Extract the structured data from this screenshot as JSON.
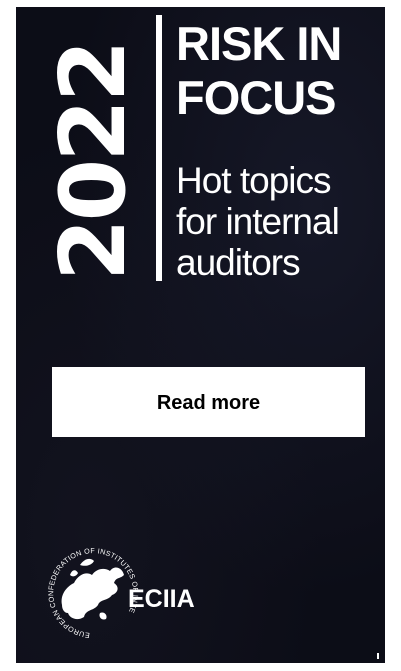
{
  "banner": {
    "year": "2022",
    "title_lines": [
      "RISK IN",
      "FOCUS"
    ],
    "subtitle_lines": [
      "Hot topics",
      "for internal",
      "auditors"
    ],
    "cta_label": "Read more",
    "logo": {
      "name": "ECIIA",
      "ring_text": "EUROPEAN CONFEDERATION OF INSTITUTES OF INTERNAL AUDITING"
    },
    "colors": {
      "background": "#0c0d17",
      "text": "#ffffff",
      "button_bg": "#ffffff",
      "button_text": "#000000"
    }
  }
}
